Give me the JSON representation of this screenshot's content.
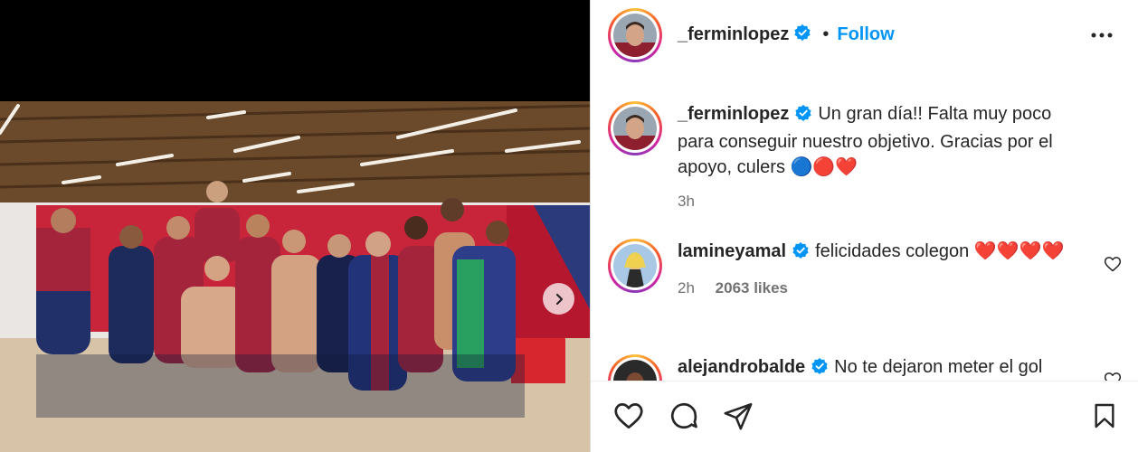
{
  "post": {
    "author": "_ferminlopez",
    "separator": "•",
    "follow_label": "Follow",
    "caption": "Un gran día!! Falta muy poco para conseguir nuestro objetivo. Gracias por el apoyo, culers 🔵🔴❤️",
    "caption_time": "3h"
  },
  "media": {
    "alt_icon": "chevron-right-icon"
  },
  "comments": [
    {
      "username": "lamineyamal",
      "text": "felicidades colegon ❤️❤️❤️❤️",
      "time": "2h",
      "likes": "2063 likes"
    },
    {
      "username": "alejandrobalde",
      "text": "No te dejaron meter el gol"
    }
  ],
  "icons": {
    "like": "heart-icon",
    "comment": "comment-icon",
    "share": "share-icon",
    "save": "bookmark-icon",
    "more": "more-options-icon",
    "verified": "verified-badge-icon"
  },
  "colors": {
    "follow_blue": "#0095f6",
    "verified_blue": "#0095f6",
    "ring_gradient": [
      "#fdc23b",
      "#f55a2a",
      "#d6249f",
      "#8a3ab9"
    ]
  }
}
